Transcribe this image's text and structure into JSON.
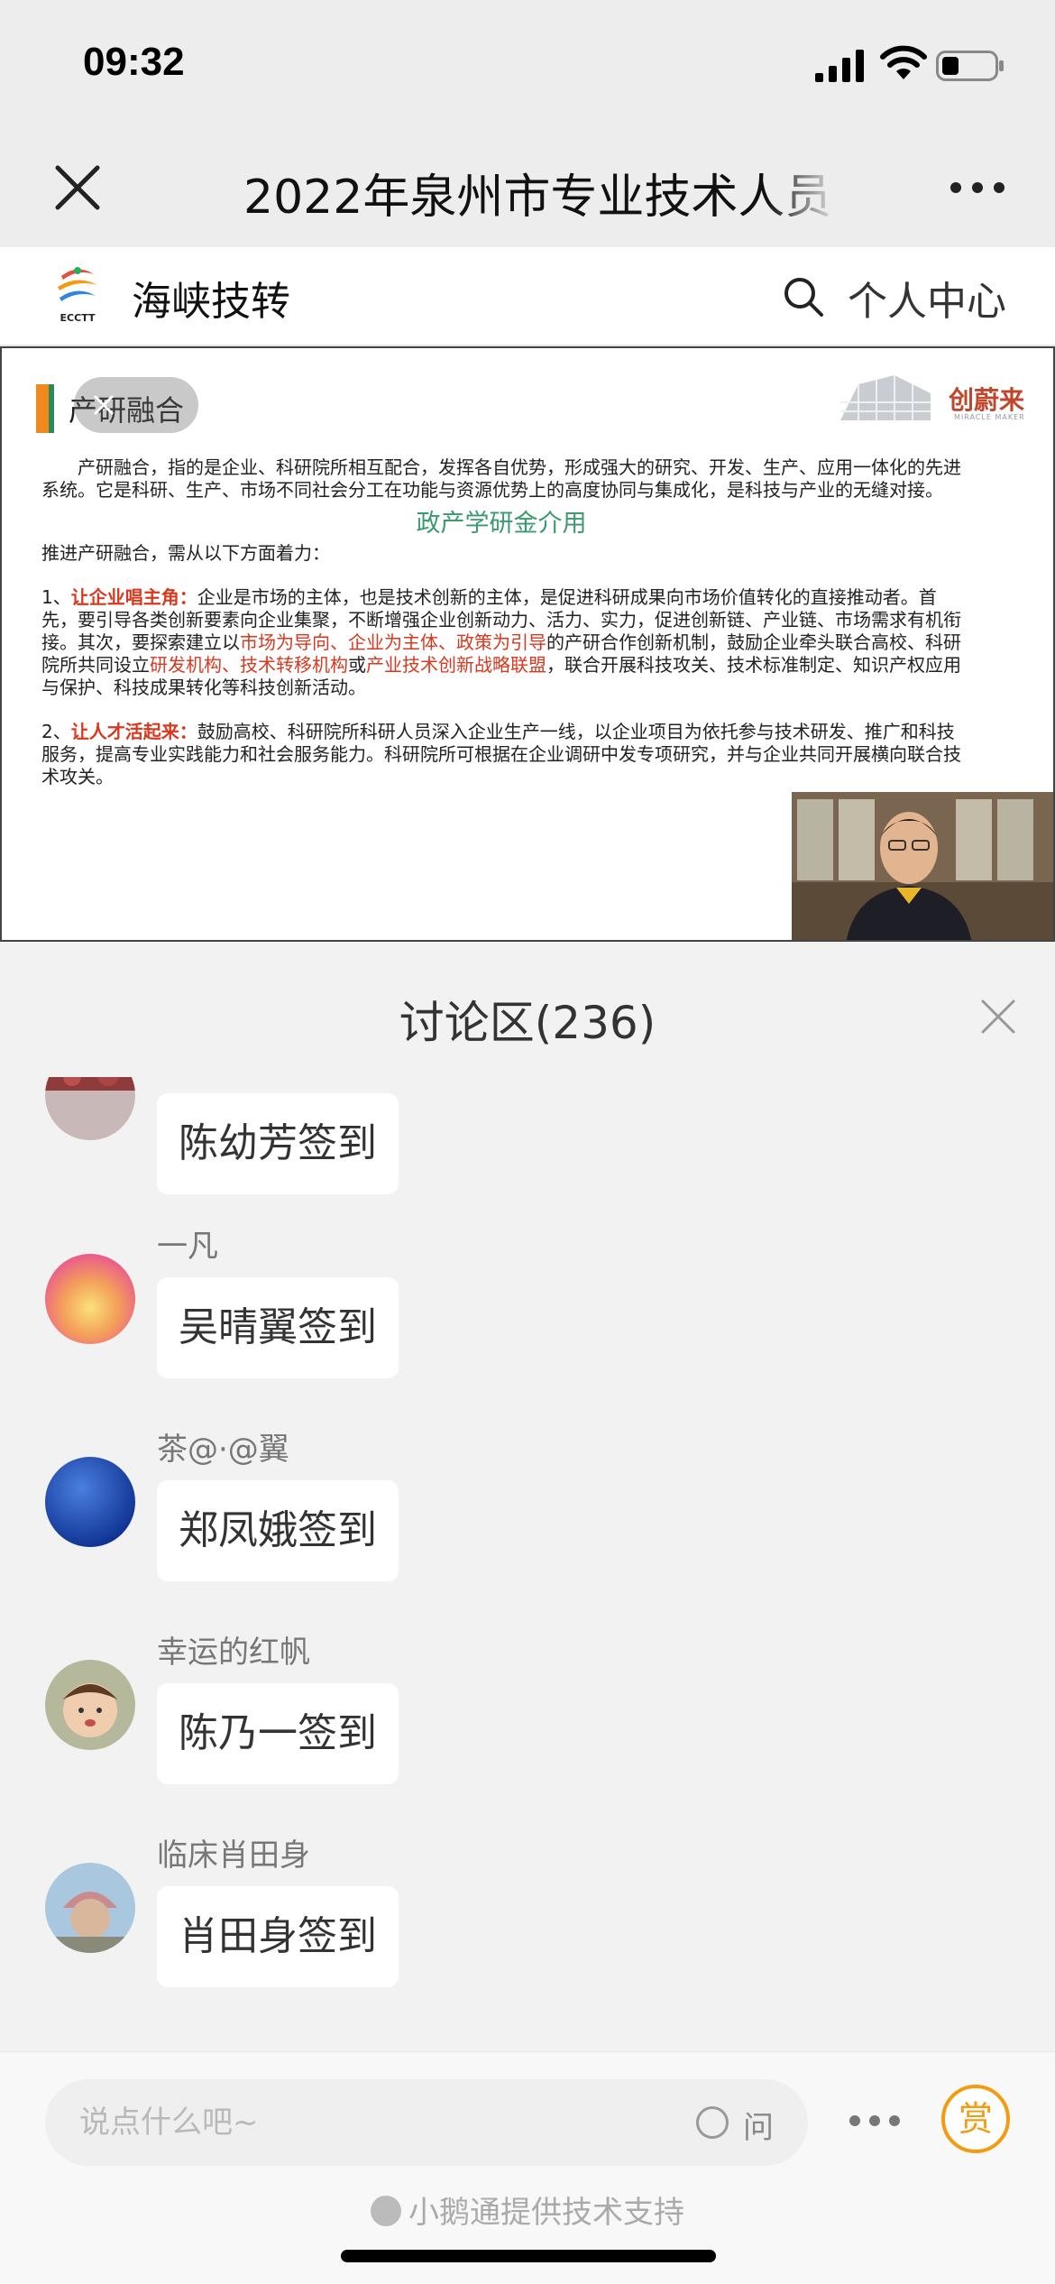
{
  "status_bar": {
    "time": "09:32"
  },
  "nav": {
    "title": "2022年泉州市专业技术人员"
  },
  "site": {
    "name": "海峡技转",
    "logo_text": "ECCTT",
    "personal_center": "个人中心"
  },
  "slide": {
    "heading": "产研融合",
    "brand_name": "创蔚来",
    "brand_sub": "MIRACLE MAKER",
    "intro": "产研融合，指的是企业、科研院所相互配合，发挥各自优势，形成强大的研究、开发、生产、应用一体化的先进系统。它是科研、生产、市场不同社会分工在功能与资源优势上的高度协同与集成化，是科技与产业的无缝对接。",
    "subtitle": "政产学研金介用",
    "lead": "推进产研融合，需从以下方面着力：",
    "point1_num": "1、",
    "point1_title": "让企业唱主角：",
    "point1_text_a": "企业是市场的主体，也是技术创新的主体，是促进科研成果向市场价值转化的直接推动者。首先，要引导各类创新要素向企业集聚，不断增强企业创新动力、活力、实力，促进创新链、产业链、市场需求有机衔接。其次，要探索建立以",
    "point1_red_a": "市场为导向、企业为主体、政策为引导",
    "point1_text_b": "的产研合作创新机制，鼓励企业牵头联合高校、科研院所共同设立",
    "point1_red_b": "研发机构、技术转移机构",
    "point1_text_c": "或",
    "point1_red_c": "产业技术创新战略联盟",
    "point1_text_d": "，联合开展科技攻关、技术标准制定、知识产权应用与保护、科技成果转化等科技创新活动。",
    "point2_num": "2、",
    "point2_title": "让人才活起来：",
    "point2_text": "鼓励高校、科研院所科研人员深入企业生产一线，以企业项目为依托参与技术研发、推广和科技服务，提高专业实践能力和社会服务能力。科研院所可根据在企业调研中发专项研究，并与企业共同开展横向联合技术攻关。"
  },
  "discussion": {
    "title": "讨论区(236)",
    "messages": [
      {
        "name": "",
        "text": "陈幼芳签到"
      },
      {
        "name": "一凡",
        "text": "吴晴翼签到"
      },
      {
        "name": "茶@·@翼",
        "text": "郑凤娥签到"
      },
      {
        "name": "幸运的红帆",
        "text": "陈乃一签到"
      },
      {
        "name": "临床肖田身",
        "text": "肖田身签到"
      }
    ]
  },
  "input": {
    "placeholder": "说点什么吧~",
    "ask_label": "问",
    "reward_label": "赏",
    "powered_by": "小鹅通提供技术支持"
  },
  "colors": {
    "accent_orange": "#f39c12",
    "slide_red": "#d9381e",
    "slide_green": "#3b9a6e"
  }
}
